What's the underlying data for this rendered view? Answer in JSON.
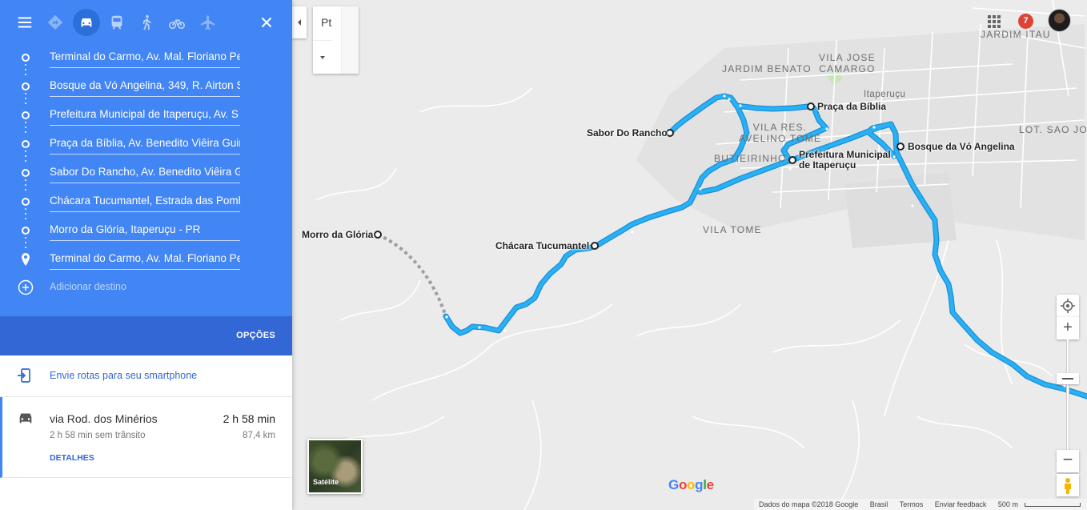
{
  "colors": {
    "sidebar_blue": "#4285f4",
    "options_bar": "#3367d6",
    "route_line": "#1aa3e8",
    "link": "#3367d6"
  },
  "travel_modes": [
    {
      "name": "best-mode",
      "icon": "directions-diamond-icon",
      "active": false
    },
    {
      "name": "car",
      "icon": "car-icon",
      "active": true
    },
    {
      "name": "transit",
      "icon": "train-icon",
      "active": false
    },
    {
      "name": "walking",
      "icon": "walk-icon",
      "active": false
    },
    {
      "name": "cycling",
      "icon": "bicycle-icon",
      "active": false
    },
    {
      "name": "flights",
      "icon": "airplane-icon",
      "active": false
    }
  ],
  "waypoints": [
    "Terminal do Carmo, Av. Mal. Floriano Pe",
    "Bosque da Vó Angelina, 349, R. Airton S",
    "Prefeitura Municipal de Itaperuçu, Av. S",
    "Praça da Bíblia, Av. Benedito Viêira Guir",
    "Sabor Do Rancho, Av. Benedito Viêira G",
    "Chácara Tucumantel, Estrada das Pomb",
    "Morro da Glória, Itaperuçu - PR",
    "Terminal do Carmo, Av. Mal. Floriano Pe"
  ],
  "add_destination": "Adicionar destino",
  "options_label": "OPÇÕES",
  "send_to_phone": "Envie rotas para seu smartphone",
  "route": {
    "via": "via Rod. dos Minérios",
    "duration": "2 h 58 min",
    "no_traffic": "2 h 58 min sem trânsito",
    "distance": "87,4 km",
    "details_label": "DETALHES"
  },
  "map": {
    "language": "Pt",
    "notifications": "7",
    "areas": {
      "jardim_itau": "JARDIM ITAU",
      "jardim_benato": "JARDIM BENATO",
      "vila_jose_camargo": "VILA JOSE\nCAMARGO",
      "itaperucu": "Itaperuçu",
      "lot_sao_joao": "LOT. SAO JOA",
      "vila_res_avelino_tome": "VILA RES.\nAVELINO TOME",
      "butieirinho": "BUTIEIRINHO",
      "vila_tome": "VILA TOME"
    },
    "places": {
      "sabor": "Sabor Do Rancho",
      "praca": "Praça da Bíblia",
      "bosque": "Bosque da Vó Angelina",
      "prefeitura": "Prefeitura Municipal\nde Itaperuçu",
      "chacara": "Chácara Tucumantel",
      "morro": "Morro da Glória"
    },
    "satellite_label": "Satélite",
    "footer": {
      "data": "Dados do mapa ©2018 Google",
      "country": "Brasil",
      "terms": "Termos",
      "feedback": "Enviar feedback",
      "scale": "500 m"
    }
  }
}
